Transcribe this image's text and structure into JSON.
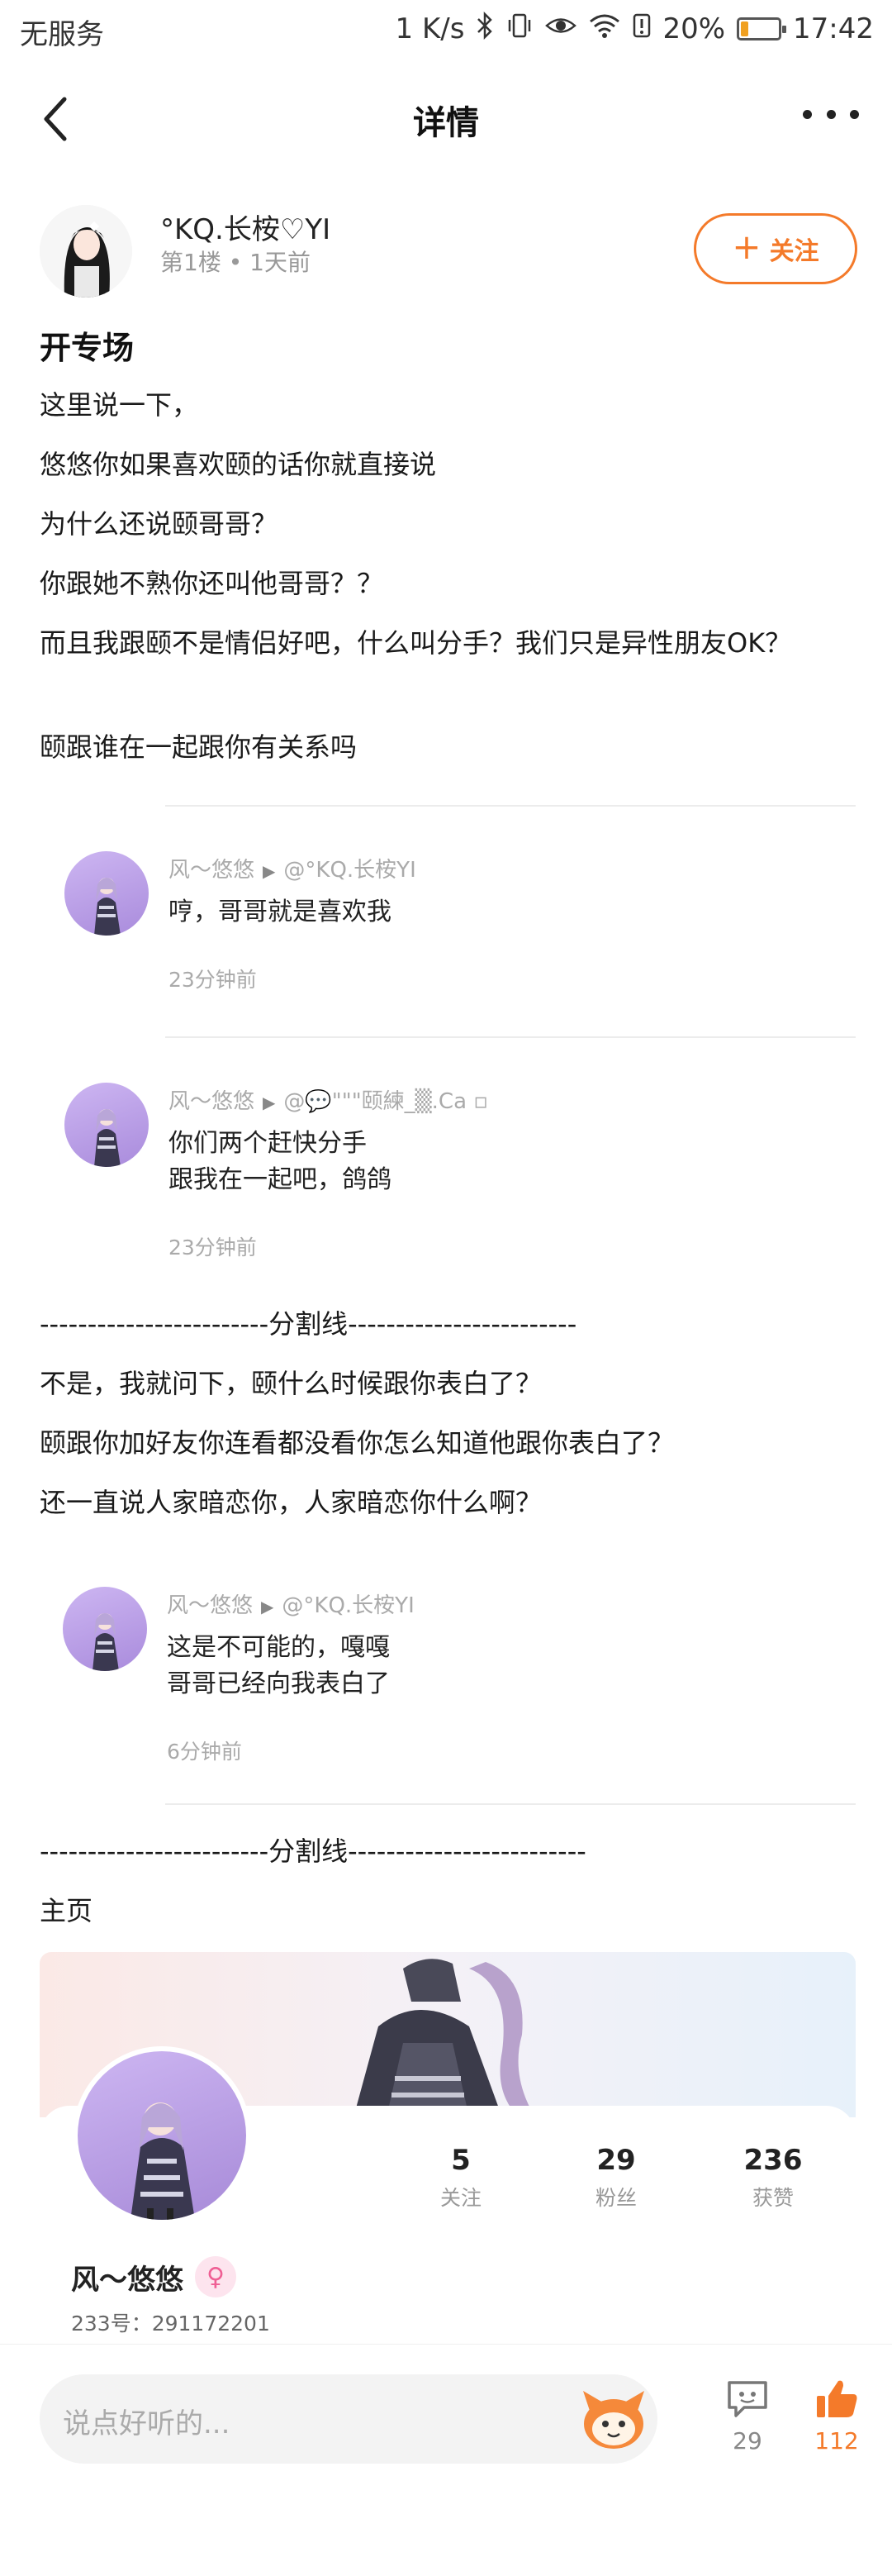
{
  "status_bar": {
    "carrier": "无服务",
    "speed": "1 K/s",
    "battery_pct": "20%",
    "battery_level": 0.2,
    "time": "17:42"
  },
  "nav": {
    "title": "详情"
  },
  "author": {
    "name": "°KQ.长桉♡YI",
    "meta": "第1楼 • 1天前",
    "follow_label": "关注"
  },
  "post": {
    "title": "开专场",
    "paragraphs_1": [
      "这里说一下，",
      "悠悠你如果喜欢颐的话你就直接说",
      "为什么还说颐哥哥？",
      "你跟她不熟你还叫他哥哥？？",
      "而且我跟颐不是情侣好吧，什么叫分手？我们只是异性朋友OK？",
      "颐跟谁在一起跟你有关系吗"
    ],
    "divider_1": "------------------------分割线------------------------",
    "paragraphs_2": [
      "不是，我就问下，颐什么时候跟你表白了？",
      "颐跟你加好友你连看都没看你怎么知道他跟你表白了？",
      "还一直说人家暗恋你，人家暗恋你什么啊？"
    ],
    "divider_2": "------------------------分割线-------------------------",
    "home_label": "主页"
  },
  "quotes": [
    {
      "user": "风～悠悠",
      "target": "@°KQ.长桉YI",
      "lines": [
        "哼，哥哥就是喜欢我"
      ],
      "time": "23分钟前"
    },
    {
      "user": "风～悠悠",
      "target": "@💬\"\"\"颐練_▒.Ca ▫",
      "lines": [
        "你们两个赶快分手",
        "跟我在一起吧，鸽鸽"
      ],
      "time": "23分钟前"
    },
    {
      "user": "风～悠悠",
      "target": "@°KQ.长桉YI",
      "lines": [
        "这是不可能的，嘎嘎",
        "哥哥已经向我表白了"
      ],
      "time": "6分钟前"
    }
  ],
  "profile_card": {
    "name": "风～悠悠",
    "gender_icon": "female-icon",
    "uid": "233号：291172201",
    "stats": [
      {
        "num": "5",
        "label": "关注"
      },
      {
        "num": "29",
        "label": "粉丝"
      },
      {
        "num": "236",
        "label": "获赞"
      }
    ]
  },
  "bottom_bar": {
    "placeholder": "说点好听的...",
    "comment_count": "29",
    "like_count": "112",
    "accent": "#f47a2a"
  }
}
